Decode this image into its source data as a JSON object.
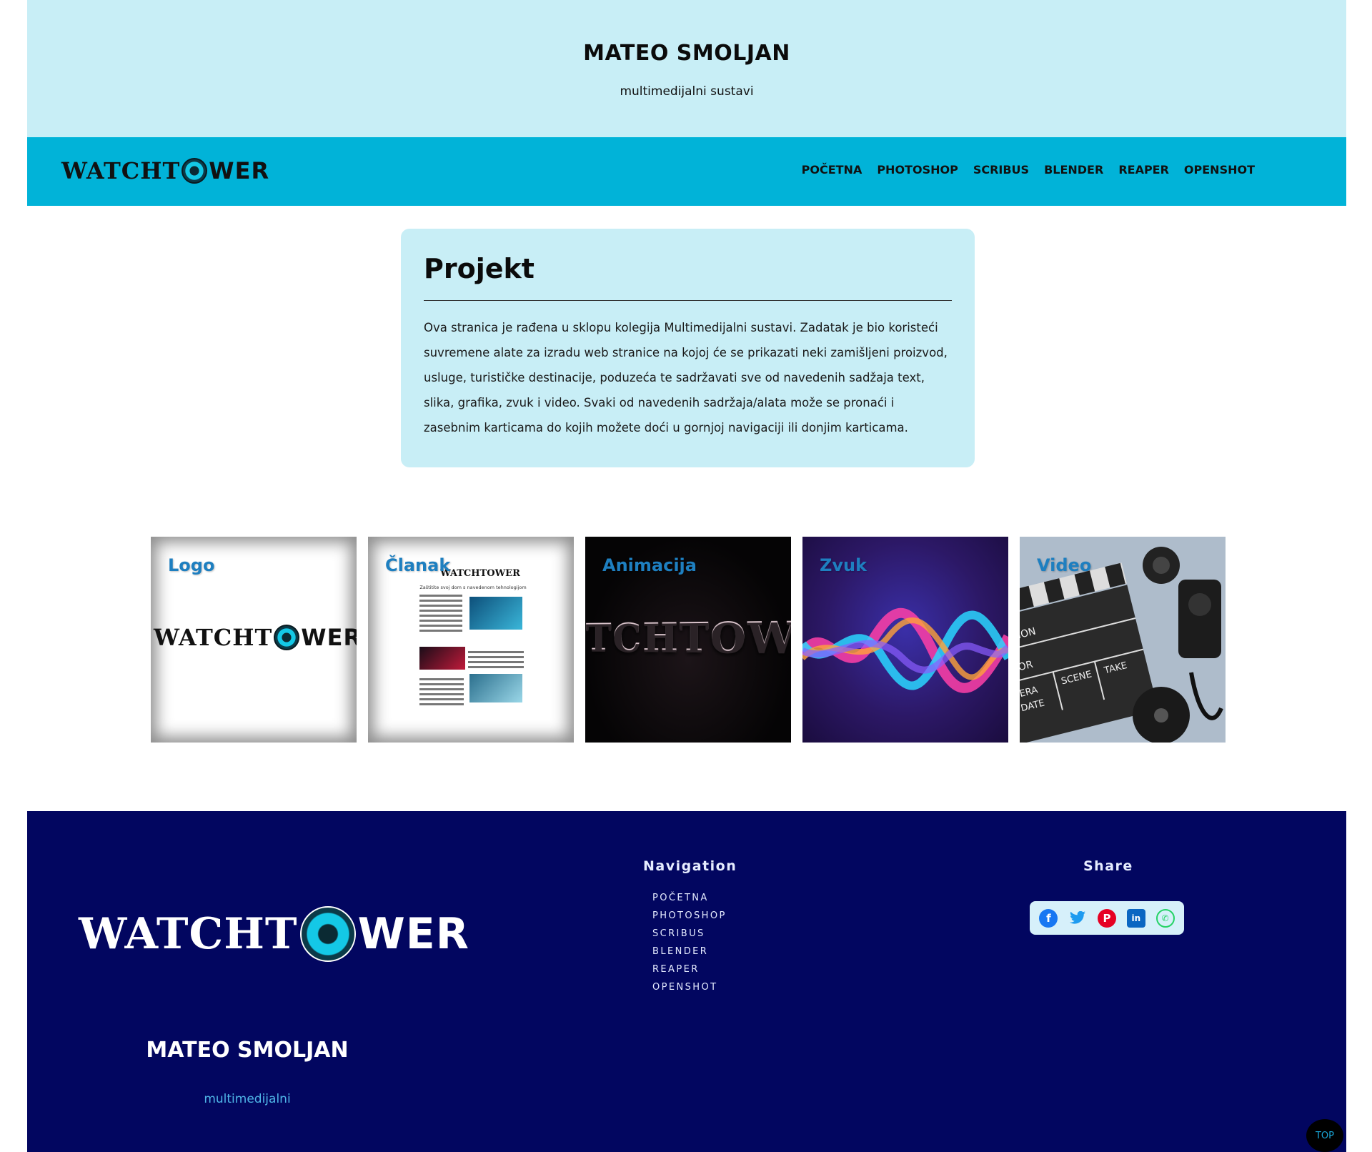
{
  "header": {
    "title": "MATEO SMOLJAN",
    "subtitle": "multimedijalni sustavi"
  },
  "nav": {
    "logo_left": "WATCHT",
    "logo_right": "WER",
    "items": [
      "POČETNA",
      "PHOTOSHOP",
      "SCRIBUS",
      "BLENDER",
      "REAPER",
      "OPENSHOT"
    ]
  },
  "project": {
    "heading": "Projekt",
    "text": "Ova stranica je rađena u sklopu kolegija Multimedijalni sustavi. Zadatak je bio koristeći suvremene alate za izradu web stranice na kojoj će se prikazati neki zamišljeni proizvod, usluge, turističke destinacije, poduzeća te sadržavati sve od navedenih sadžaja text, slika, grafika, zvuk i video. Svaki od navedenih sadržaja/alata može se pronaći i zasebnim karticama do kojih možete doći u gornjoj navigaciji ili donjim karticama."
  },
  "tiles": [
    {
      "label": "Logo"
    },
    {
      "label": "Članak"
    },
    {
      "label": "Animacija"
    },
    {
      "label": "Zvuk"
    },
    {
      "label": "Video"
    }
  ],
  "tile_art": {
    "doc_logo_left": "WATCHT",
    "doc_logo_right": "WER",
    "doc_heading": "Zaštitite svoj dom s navedenom tehnologijom",
    "anim_text": "TCHTOWE",
    "clapper": {
      "a": "UCTION",
      "b": "CTOR",
      "c": "MERA",
      "d": "DATE",
      "e": "SCENE",
      "f": "TAKE"
    }
  },
  "footer": {
    "logo_left": "WATCHT",
    "logo_right": "WER",
    "name": "MATEO SMOLJAN",
    "subtitle": "multimedijalni",
    "nav_heading": "Navigation",
    "nav_items": [
      "POČETNA",
      "PHOTOSHOP",
      "SCRIBUS",
      "BLENDER",
      "REAPER",
      "OPENSHOT"
    ],
    "share_heading": "Share",
    "share_icons": [
      {
        "name": "facebook-icon",
        "glyph": "f",
        "color": "#1877f2"
      },
      {
        "name": "twitter-icon",
        "glyph": "t",
        "color": "#1d9bf0"
      },
      {
        "name": "pinterest-icon",
        "glyph": "p",
        "color": "#e60023"
      },
      {
        "name": "linkedin-icon",
        "glyph": "in",
        "color": "#0a66c2"
      },
      {
        "name": "whatsapp-icon",
        "glyph": "w",
        "color": "#25d366"
      }
    ],
    "top_button": "TOP"
  },
  "colors": {
    "header_bg": "#c8eef6",
    "nav_bg": "#01b3d8",
    "footer_bg": "#020660",
    "tile_title": "#1e7fc0"
  }
}
